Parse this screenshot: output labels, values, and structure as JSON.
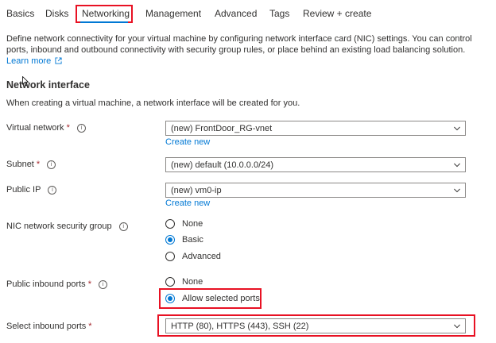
{
  "tabs": [
    {
      "label": "Basics"
    },
    {
      "label": "Disks"
    },
    {
      "label": "Networking"
    },
    {
      "label": "Management"
    },
    {
      "label": "Advanced"
    },
    {
      "label": "Tags"
    },
    {
      "label": "Review + create"
    }
  ],
  "active_tab": "Networking",
  "description": {
    "text": "Define network connectivity for your virtual machine by configuring network interface card (NIC) settings. You can control ports, inbound and outbound connectivity with security group rules, or place behind an existing load balancing solution.",
    "learn_more": "Learn more"
  },
  "section": {
    "title": "Network interface",
    "subtitle": "When creating a virtual machine, a network interface will be created for you."
  },
  "fields": {
    "virtual_network": {
      "label": "Virtual network",
      "required": "*",
      "value": "(new) FrontDoor_RG-vnet",
      "create_new": "Create new"
    },
    "subnet": {
      "label": "Subnet",
      "required": "*",
      "value": "(new) default (10.0.0.0/24)"
    },
    "public_ip": {
      "label": "Public IP",
      "value": "(new) vm0-ip",
      "create_new": "Create new"
    },
    "nic_nsg": {
      "label": "NIC network security group",
      "options": [
        "None",
        "Basic",
        "Advanced"
      ],
      "selected": "Basic"
    },
    "public_inbound_ports": {
      "label": "Public inbound ports",
      "required": "*",
      "options": [
        "None",
        "Allow selected ports"
      ],
      "selected": "Allow selected ports"
    },
    "select_inbound_ports": {
      "label": "Select inbound ports",
      "required": "*",
      "value": "HTTP (80), HTTPS (443), SSH (22)"
    }
  },
  "info_glyph": "i",
  "colors": {
    "accent": "#0078d4",
    "highlight": "#e81123",
    "required": "#a4262c"
  }
}
